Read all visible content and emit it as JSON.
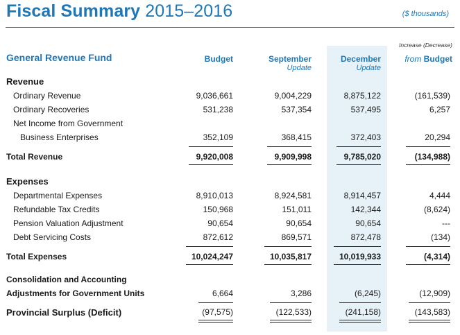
{
  "header": {
    "title_bold": "Fiscal Summary",
    "title_years": "2015–2016",
    "units": "($ thousands)"
  },
  "columns": {
    "fund_label": "General Revenue Fund",
    "budget": "Budget",
    "september": "September",
    "september_sub": "Update",
    "december": "December",
    "december_sub": "Update",
    "change_top": "Increase (Decrease)",
    "change_from": "from",
    "change_budget": "Budget"
  },
  "revenue": {
    "heading": "Revenue",
    "rows": [
      {
        "label": "Ordinary Revenue",
        "budget": "9,036,661",
        "september": "9,004,229",
        "december": "8,875,122",
        "change": "(161,539)"
      },
      {
        "label": "Ordinary Recoveries",
        "budget": "531,238",
        "september": "537,354",
        "december": "537,495",
        "change": "6,257"
      },
      {
        "label": "Net Income from Government",
        "budget": "",
        "september": "",
        "december": "",
        "change": ""
      },
      {
        "label": "Business Enterprises",
        "budget": "352,109",
        "september": "368,415",
        "december": "372,403",
        "change": "20,294"
      }
    ],
    "total": {
      "label": "Total Revenue",
      "budget": "9,920,008",
      "september": "9,909,998",
      "december": "9,785,020",
      "change": "(134,988)"
    }
  },
  "expenses": {
    "heading": "Expenses",
    "rows": [
      {
        "label": "Departmental Expenses",
        "budget": "8,910,013",
        "september": "8,924,581",
        "december": "8,914,457",
        "change": "4,444"
      },
      {
        "label": "Refundable Tax Credits",
        "budget": "150,968",
        "september": "151,011",
        "december": "142,344",
        "change": "(8,624)"
      },
      {
        "label": "Pension Valuation Adjustment",
        "budget": "90,654",
        "september": "90,654",
        "december": "90,654",
        "change": "---"
      },
      {
        "label": "Debt Servicing Costs",
        "budget": "872,612",
        "september": "869,571",
        "december": "872,478",
        "change": "(134)"
      }
    ],
    "total": {
      "label": "Total Expenses",
      "budget": "10,024,247",
      "september": "10,035,817",
      "december": "10,019,933",
      "change": "(4,314)"
    }
  },
  "consolidation": {
    "line1": "Consolidation and Accounting",
    "line2": "Adjustments for Government Units",
    "budget": "6,664",
    "september": "3,286",
    "december": "(6,245)",
    "change": "(12,909)"
  },
  "surplus": {
    "label": "Provincial Surplus (Deficit)",
    "budget": "(97,575)",
    "september": "(122,533)",
    "december": "(241,158)",
    "change": "(143,583)"
  }
}
